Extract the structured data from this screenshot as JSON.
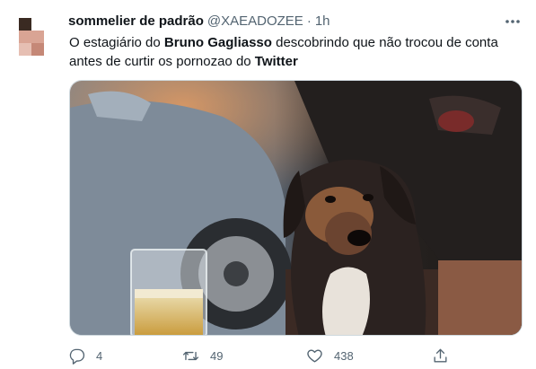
{
  "tweet": {
    "author": {
      "display_name": "sommelier de padrão",
      "handle": "@XAEADOZEE",
      "separator": "·",
      "time": "1h"
    },
    "text": {
      "part1": "O estagiário do ",
      "bold1": "Bruno Gagliasso",
      "part2": " descobrindo que não trocou de conta antes de curtir os pornozao do ",
      "bold2": "Twitter"
    },
    "media": {
      "alt": "Dog looking guilty next to a glass of beer in front of parked cars"
    },
    "actions": {
      "reply_count": "4",
      "retweet_count": "49",
      "like_count": "438"
    }
  },
  "colors": {
    "text_primary": "#0f1419",
    "text_secondary": "#536471",
    "border": "#cfd9de"
  },
  "icons": {
    "more": "more-horizontal-icon",
    "reply": "reply-icon",
    "retweet": "retweet-icon",
    "like": "heart-icon",
    "share": "share-icon"
  }
}
